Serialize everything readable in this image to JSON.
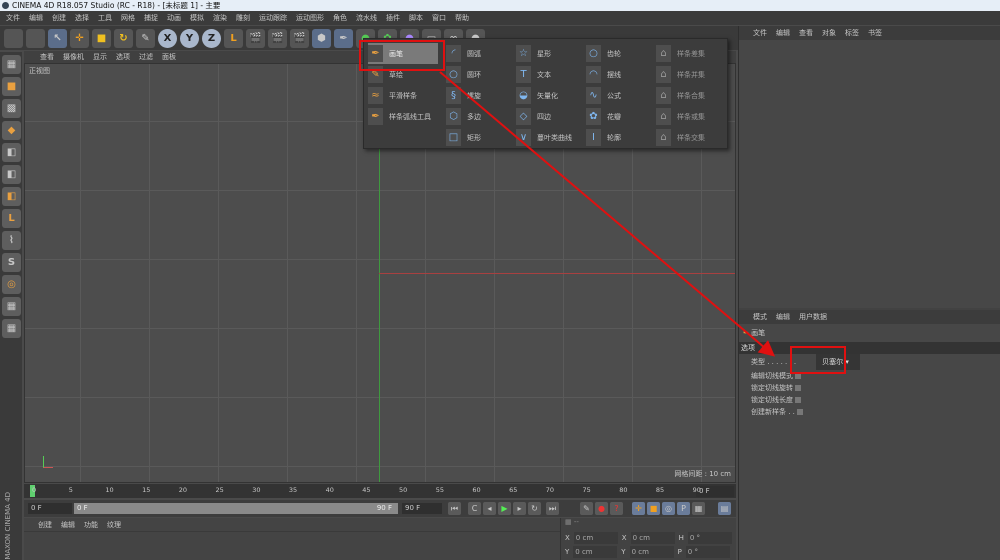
{
  "window": {
    "title": "CINEMA 4D R18.057 Studio (RC - R18) - [未标题 1] - 主要"
  },
  "menubar": [
    "文件",
    "编辑",
    "创建",
    "选择",
    "工具",
    "网格",
    "捕捉",
    "动画",
    "模拟",
    "渲染",
    "雕刻",
    "运动跟踪",
    "运动图形",
    "角色",
    "流水线",
    "插件",
    "脚本",
    "窗口",
    "帮助"
  ],
  "toolbar": {
    "axis": [
      "X",
      "Y",
      "Z"
    ]
  },
  "viewport": {
    "menu": [
      "查看",
      "摄像机",
      "显示",
      "选项",
      "过滤",
      "面板"
    ],
    "label": "正视图",
    "grid_spacing": "网格间距 : 10 cm"
  },
  "spline_popup": {
    "columns": [
      [
        {
          "label": "画笔",
          "icon": "pen-icon",
          "selected": true
        },
        {
          "label": "草绘",
          "icon": "sketch-icon"
        },
        {
          "label": "平滑样条",
          "icon": "smooth-spline-icon"
        },
        {
          "label": "样条弧线工具",
          "icon": "spline-arc-icon"
        }
      ],
      [
        {
          "label": "圆弧",
          "icon": "arc-icon"
        },
        {
          "label": "圆环",
          "icon": "circle-icon"
        },
        {
          "label": "螺旋",
          "icon": "helix-icon"
        },
        {
          "label": "多边",
          "icon": "polygon-icon"
        },
        {
          "label": "矩形",
          "icon": "rectangle-icon"
        }
      ],
      [
        {
          "label": "星形",
          "icon": "star-icon"
        },
        {
          "label": "文本",
          "icon": "text-icon"
        },
        {
          "label": "矢量化",
          "icon": "vectorize-icon"
        },
        {
          "label": "四边",
          "icon": "four-side-icon"
        },
        {
          "label": "蔓叶类曲线",
          "icon": "cissoid-icon"
        }
      ],
      [
        {
          "label": "齿轮",
          "icon": "gear-icon"
        },
        {
          "label": "摆线",
          "icon": "cycloid-icon"
        },
        {
          "label": "公式",
          "icon": "formula-icon"
        },
        {
          "label": "花瓣",
          "icon": "flower-icon"
        },
        {
          "label": "轮廓",
          "icon": "profile-icon"
        }
      ],
      [
        {
          "label": "样条差集",
          "icon": "spline-subtract-icon",
          "disabled": true
        },
        {
          "label": "样条并集",
          "icon": "spline-union-icon",
          "disabled": true
        },
        {
          "label": "样条合集",
          "icon": "spline-and-icon",
          "disabled": true
        },
        {
          "label": "样条或集",
          "icon": "spline-or-icon",
          "disabled": true
        },
        {
          "label": "样条交集",
          "icon": "spline-intersect-icon",
          "disabled": true
        }
      ]
    ]
  },
  "object_manager": {
    "menu": [
      "文件",
      "编辑",
      "查看",
      "对象",
      "标签",
      "书签"
    ]
  },
  "attributes": {
    "menu": [
      "模式",
      "编辑",
      "用户数据"
    ],
    "tool_name": "画笔",
    "section": "选项",
    "type_label": "类型 . . . . . . .",
    "type_value": "贝塞尔",
    "options": [
      "编辑切线模式",
      "锁定切线旋转",
      "锁定切线长度",
      "创建新样条 . ."
    ]
  },
  "timeline": {
    "ticks": [
      "0",
      "5",
      "10",
      "15",
      "20",
      "25",
      "30",
      "35",
      "40",
      "45",
      "50",
      "55",
      "60",
      "65",
      "70",
      "75",
      "80",
      "85",
      "90"
    ],
    "current_frame": "0 F"
  },
  "controls": {
    "start": "0 F",
    "range_start": "0 F",
    "range_end": "90 F",
    "end": "90 F"
  },
  "material_manager": {
    "menu": [
      "创建",
      "编辑",
      "功能",
      "纹理"
    ]
  },
  "coordinates": {
    "rows": [
      [
        "X",
        "0 cm",
        "X",
        "0 cm",
        "H",
        "0 °"
      ],
      [
        "Y",
        "0 cm",
        "Y",
        "0 cm",
        "P",
        "0 °"
      ]
    ]
  },
  "brand_vertical": "MAXON CINEMA 4D",
  "colors": {
    "highlight": "#e01010",
    "accent": "#7fb6ee"
  }
}
